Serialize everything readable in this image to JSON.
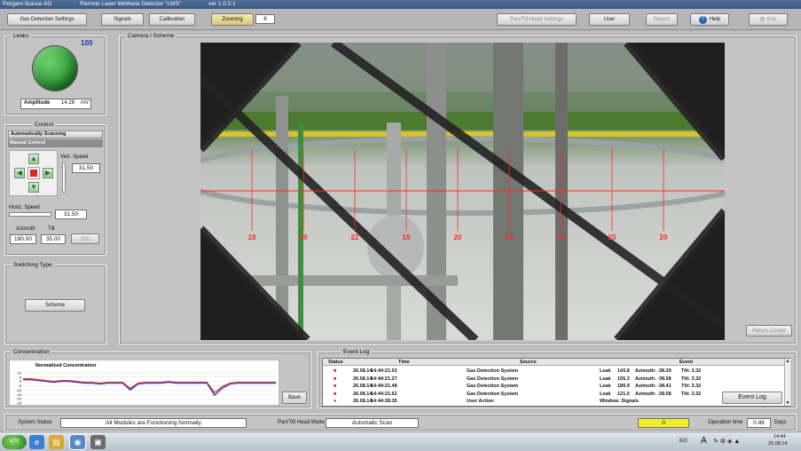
{
  "window": {
    "company": "Pergam-Suisse AG",
    "app_title": "Remote Laser Methane Detector  \"LMS\"",
    "version": "ver  1.0.2.1"
  },
  "toolbar": {
    "gas_detection_settings": "Gas Detection Settings",
    "signals": "Signals",
    "calibration": "Calibration",
    "zooming": "Zooming",
    "zoom_value": "6",
    "pan_tilt_head_settings": "Pan/Tilt Head Settings",
    "user": "User",
    "report": "Report",
    "help": "Help",
    "exit": "Exit"
  },
  "leak": {
    "title": "Leaks",
    "value": "100",
    "amplitude_label": "Amplitude",
    "amplitude_value": "14.26",
    "amplitude_unit": "mV",
    "indicator_color": "#2f9a36"
  },
  "control": {
    "title": "Control",
    "auto_scanning": "Automatically Scanning",
    "manual_control": "Manual Control",
    "vert_speed_label": "Vert. Speed",
    "vert_speed_value": "31.50",
    "horiz_speed_label": "Horiz. Speed",
    "horiz_speed_value": "31.50",
    "azimuth_label": "Azimuth",
    "azimuth_value": "180.00",
    "tilt_label": "Tilt",
    "tilt_value": "35.00",
    "fix_label": "FIX",
    "stop_color": "#d42b1e"
  },
  "switching": {
    "title": "Switching Type",
    "scheme_button": "Scheme"
  },
  "camera": {
    "title": "Camera / Scheme",
    "markers": [
      "18",
      "20",
      "22",
      "19",
      "20",
      "60",
      "72",
      "20",
      "20"
    ],
    "return_center": "Return Center",
    "crosshair_color": "#ff2a2a"
  },
  "concentration": {
    "title": "Concentration",
    "chart_title": "Normalized Concentration",
    "base_button": "Base"
  },
  "chart_data": {
    "type": "line",
    "title": "Normalized Concentration",
    "xlabel": "",
    "ylabel": "",
    "ylim": [
      -25,
      15
    ],
    "yticks": [
      "10",
      "5",
      "0",
      "-5",
      "-10",
      "-15",
      "-20",
      "-25"
    ],
    "series": [
      {
        "color": "#2b3fd6",
        "values": [
          2,
          2,
          1,
          0,
          -1,
          0,
          0,
          -1,
          -2,
          -2,
          -3,
          -2,
          -2,
          -2,
          -10,
          -3,
          -2,
          -2,
          -2,
          -1,
          -2,
          -2,
          -2,
          -2,
          -2,
          -16,
          -8,
          -3,
          -2,
          -2,
          -2,
          -2,
          -2,
          -2
        ]
      },
      {
        "color": "#d63a2b",
        "values": [
          3,
          3,
          2,
          1,
          0,
          1,
          1,
          0,
          -1,
          -1,
          -2,
          -1,
          -1,
          -1,
          -8,
          -2,
          -1,
          -1,
          -1,
          0,
          -1,
          -1,
          -1,
          -1,
          -1,
          -13,
          -6,
          -2,
          -1,
          -1,
          -1,
          -1,
          -1,
          -1
        ]
      }
    ]
  },
  "event_log": {
    "title": "Event Log",
    "columns": [
      "Status",
      "Time",
      "Source",
      "Event"
    ],
    "rows": [
      {
        "date": "26.08.14",
        "time": "14:44:21.03",
        "source": "Gas Detection System",
        "event": "Leak",
        "value": "143.8",
        "azimuth": "Azimuth: -38.29",
        "tilt": "Tilt: 3.32"
      },
      {
        "date": "26.08.14",
        "time": "14:44:21.27",
        "source": "Gas Detection System",
        "event": "Leak",
        "value": "155.3",
        "azimuth": "Azimuth: -38.58",
        "tilt": "Tilt: 3.32"
      },
      {
        "date": "26.08.14",
        "time": "14:44:21.48",
        "source": "Gas Detection System",
        "event": "Leak",
        "value": "189.9",
        "azimuth": "Azimuth: -38.41",
        "tilt": "Tilt: 3.32"
      },
      {
        "date": "26.08.14",
        "time": "14:44:21.62",
        "source": "Gas Detection System",
        "event": "Leak",
        "value": "121.0",
        "azimuth": "Azimuth: -38.58",
        "tilt": "Tilt: 3.32"
      },
      {
        "date": "26.08.14",
        "time": "14:44:28.35",
        "source": "User Action",
        "event": "Window: Signals",
        "value": "",
        "azimuth": "",
        "tilt": ""
      }
    ],
    "button": "Event Log"
  },
  "status_bar": {
    "system_status_label": "System Status",
    "system_status_value": "All Modules are Functioning Normally",
    "mode_label": "Pan/Tilt Head Mode",
    "mode_value": "Automatic Scan",
    "counter": "0",
    "operation_time_label": "Operation time",
    "operation_time_value": "0.46",
    "days_label": "Days"
  },
  "taskbar": {
    "start": "시작",
    "tray_lang": "KO",
    "tray_letter": "A",
    "clock_time": "14:44",
    "clock_date": "26.08.14"
  }
}
